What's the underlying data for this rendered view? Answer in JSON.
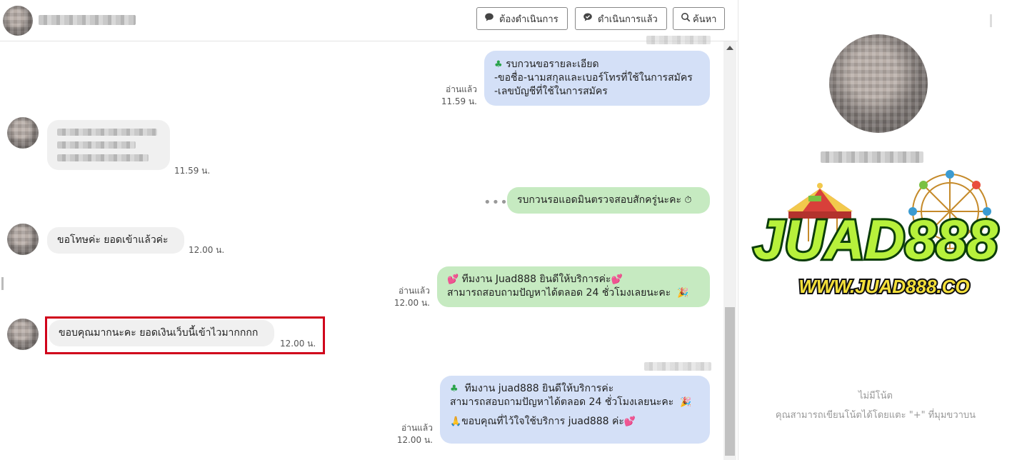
{
  "header": {
    "buttons": {
      "pending_label": "ต้องดำเนินการ",
      "done_label": "ดำเนินการแล้ว",
      "search_label": "ค้นหา"
    }
  },
  "messages": {
    "m1": {
      "read": "อ่านแล้ว",
      "time": "11.59 น.",
      "lines": [
        "รบกวนขอรายละเอียด",
        "-ขอชื่อ-นามสกุลและเบอร์โทรที่ใช้ในการสมัคร",
        "-เลขบัญชีที่ใช้ในการสมัคร"
      ]
    },
    "m2": {
      "time": "11.59 น."
    },
    "m3": {
      "text": "รบกวนรอแอดมินตรวจสอบสักครู่นะคะ"
    },
    "m4": {
      "text": "ขอโทษค่ะ ยอดเข้าแล้วค่ะ",
      "time": "12.00 น."
    },
    "m5": {
      "read": "อ่านแล้ว",
      "time": "12.00 น.",
      "lines": [
        "ทีมงาน Juad888 ยินดีให้บริการค่ะ",
        "สามารถสอบถามปัญหาได้ตลอด 24 ชั่วโมงเลยนะคะ"
      ]
    },
    "m6": {
      "text": "ขอบคุณมากนะคะ ยอดเงินเว็บนี้เข้าไวมากกกก",
      "time": "12.00 น."
    },
    "m7": {
      "read": "อ่านแล้ว",
      "time": "12.00 น.",
      "lines": [
        "ทีมงาน juad888 ยินดีให้บริการค่ะ",
        "สามารถสอบถามปัญหาได้ตลอด 24 ชั่วโมงเลยนะคะ",
        "ขอบคุณที่ไว้ใจใช้บริการ juad888 ค่ะ"
      ]
    }
  },
  "sidebar": {
    "logo_text": "JUAD888",
    "logo_url": "WWW.JUAD888.CO",
    "no_notes": "ไม่มีโน้ต",
    "notes_hint": "คุณสามารถเขียนโน้ตได้โดยแตะ \"+\" ที่มุมขวาบน"
  },
  "colors": {
    "bubble_blue": "#d4e0f7",
    "bubble_green": "#c6eac1",
    "bubble_gray": "#f0f0f0",
    "highlight_red": "#d0021b"
  }
}
